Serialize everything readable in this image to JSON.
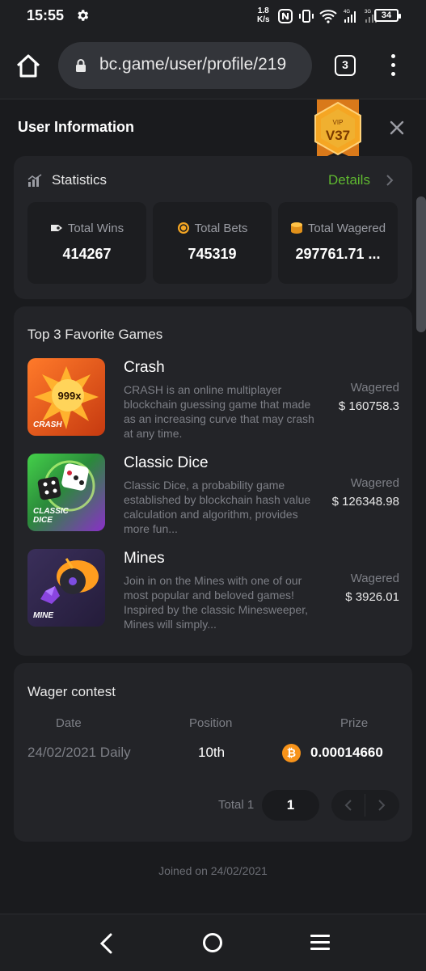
{
  "status_bar": {
    "time": "15:55",
    "net_speed_value": "1.8",
    "net_speed_unit": "K/s",
    "battery": "34",
    "icons": [
      "gear-icon",
      "nfc-icon",
      "vibrate-icon",
      "wifi-icon",
      "signal-4g-icon",
      "signal-3g-icon"
    ]
  },
  "browser": {
    "url": "bc.game/user/profile/219",
    "tab_count": "3",
    "icons": [
      "home-icon",
      "lock-icon",
      "more-vert-icon"
    ]
  },
  "modal": {
    "title": "User Information",
    "vip_label": "VIP",
    "vip_level": "V37"
  },
  "statistics": {
    "title": "Statistics",
    "details_label": "Details",
    "items": [
      {
        "label": "Total Wins",
        "value": "414267",
        "icon": "wins-icon"
      },
      {
        "label": "Total Bets",
        "value": "745319",
        "icon": "bets-icon"
      },
      {
        "label": "Total Wagered",
        "value": "297761.71 ...",
        "icon": "coins-stack-icon"
      }
    ]
  },
  "favorites": {
    "title": "Top 3 Favorite Games",
    "games": [
      {
        "name": "Crash",
        "thumb_label": "CRASH",
        "thumb_badge": "999x",
        "description": "CRASH is an online multiplayer blockchain guessing game that made as an increasing curve that may crash at any time.",
        "wagered_label": "Wagered",
        "wagered_value": "$ 160758.3"
      },
      {
        "name": "Classic Dice",
        "thumb_label": "CLASSIC DICE",
        "description": "Classic Dice, a probability game established by blockchain hash value calculation and algorithm, provides more fun...",
        "wagered_label": "Wagered",
        "wagered_value": "$ 126348.98"
      },
      {
        "name": "Mines",
        "thumb_label": "MINE",
        "description": "Join in on the Mines with one of our most popular and beloved games! Inspired by the classic Minesweeper, Mines will simply...",
        "wagered_label": "Wagered",
        "wagered_value": "$ 3926.01"
      }
    ]
  },
  "wager_contest": {
    "title": "Wager contest",
    "headers": {
      "date": "Date",
      "position": "Position",
      "prize": "Prize"
    },
    "rows": [
      {
        "date": "24/02/2021 Daily",
        "position": "10th",
        "prize": "0.00014660",
        "coin": "₿"
      }
    ],
    "total_label": "Total 1",
    "current_page": "1"
  },
  "footer": {
    "joined": "Joined on 24/02/2021"
  },
  "colors": {
    "background": "#1a1b1e",
    "card": "#232428",
    "accent_green": "#5fb830",
    "vip_gold": "#f0a020",
    "bitcoin": "#f7931a"
  }
}
